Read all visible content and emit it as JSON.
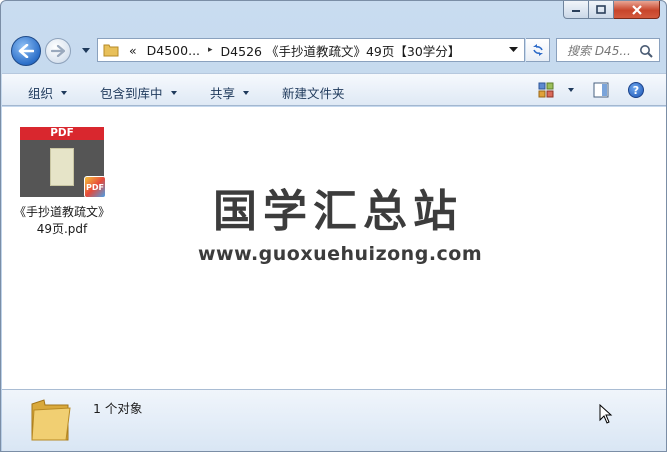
{
  "window": {
    "caption_buttons": [
      "minimize-icon",
      "maximize-icon",
      "close-icon"
    ]
  },
  "address": {
    "prefix": "«",
    "crumb_1": "D4500...",
    "separator": "▸",
    "crumb_2": "D4526 《手抄道教疏文》49页【30学分】"
  },
  "search": {
    "placeholder": "搜索 D45..."
  },
  "toolbar": {
    "organize": "组织",
    "include_in_library": "包含到库中",
    "share": "共享",
    "new_folder": "新建文件夹",
    "help": "?"
  },
  "file": {
    "thumb_label": "PDF",
    "badge_label": "PDF",
    "name": "《手抄道教疏文》49页.pdf"
  },
  "watermark": {
    "title": "国学汇总站",
    "url": "www.guoxuehuizong.com"
  },
  "status": {
    "count_text": "1 个对象"
  },
  "colors": {
    "pdf_red": "#d9272e",
    "toolbar_text": "#1e395b"
  }
}
